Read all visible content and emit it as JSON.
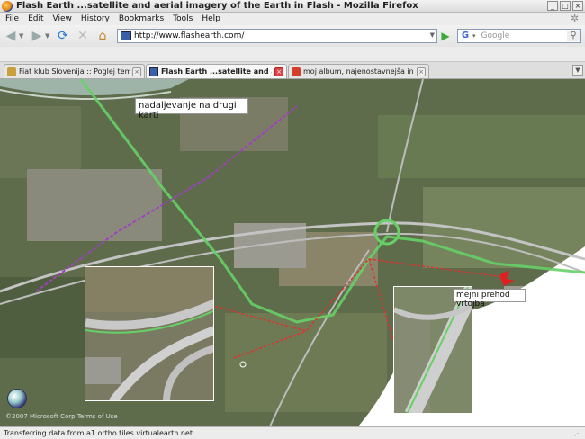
{
  "window": {
    "title": "Flash Earth ...satellite and aerial imagery of the Earth in Flash - Mozilla Firefox",
    "minimize": "_",
    "maximize": "□",
    "close": "×"
  },
  "menu": {
    "items": [
      "File",
      "Edit",
      "View",
      "History",
      "Bookmarks",
      "Tools",
      "Help"
    ]
  },
  "navigation": {
    "url": "http://www.flashearth.com/",
    "search_placeholder": "Google"
  },
  "tabs": [
    {
      "label": "Fiat klub Slovenija :: Poglej temo - Nas...",
      "active": false,
      "close": "×"
    },
    {
      "label": "Flash Earth ...satellite and aerial i...",
      "active": true,
      "close": "×"
    },
    {
      "label": "moj album, najenostavnejša in najprij...",
      "active": false,
      "close": "×"
    }
  ],
  "map": {
    "callout_top": "nadaljevanje na drugi karti",
    "callout_border": "mejni prehod vrtojba",
    "copyright": "©2007 Microsoft Corp   Terms of Use"
  },
  "status": {
    "text": "Transferring data from a1.ortho.tiles.virtualearth.net..."
  },
  "colors": {
    "route_green": "#66d066",
    "route_purple": "#a040c0",
    "route_red": "#e03030",
    "terrain": "#5b6b4a"
  }
}
